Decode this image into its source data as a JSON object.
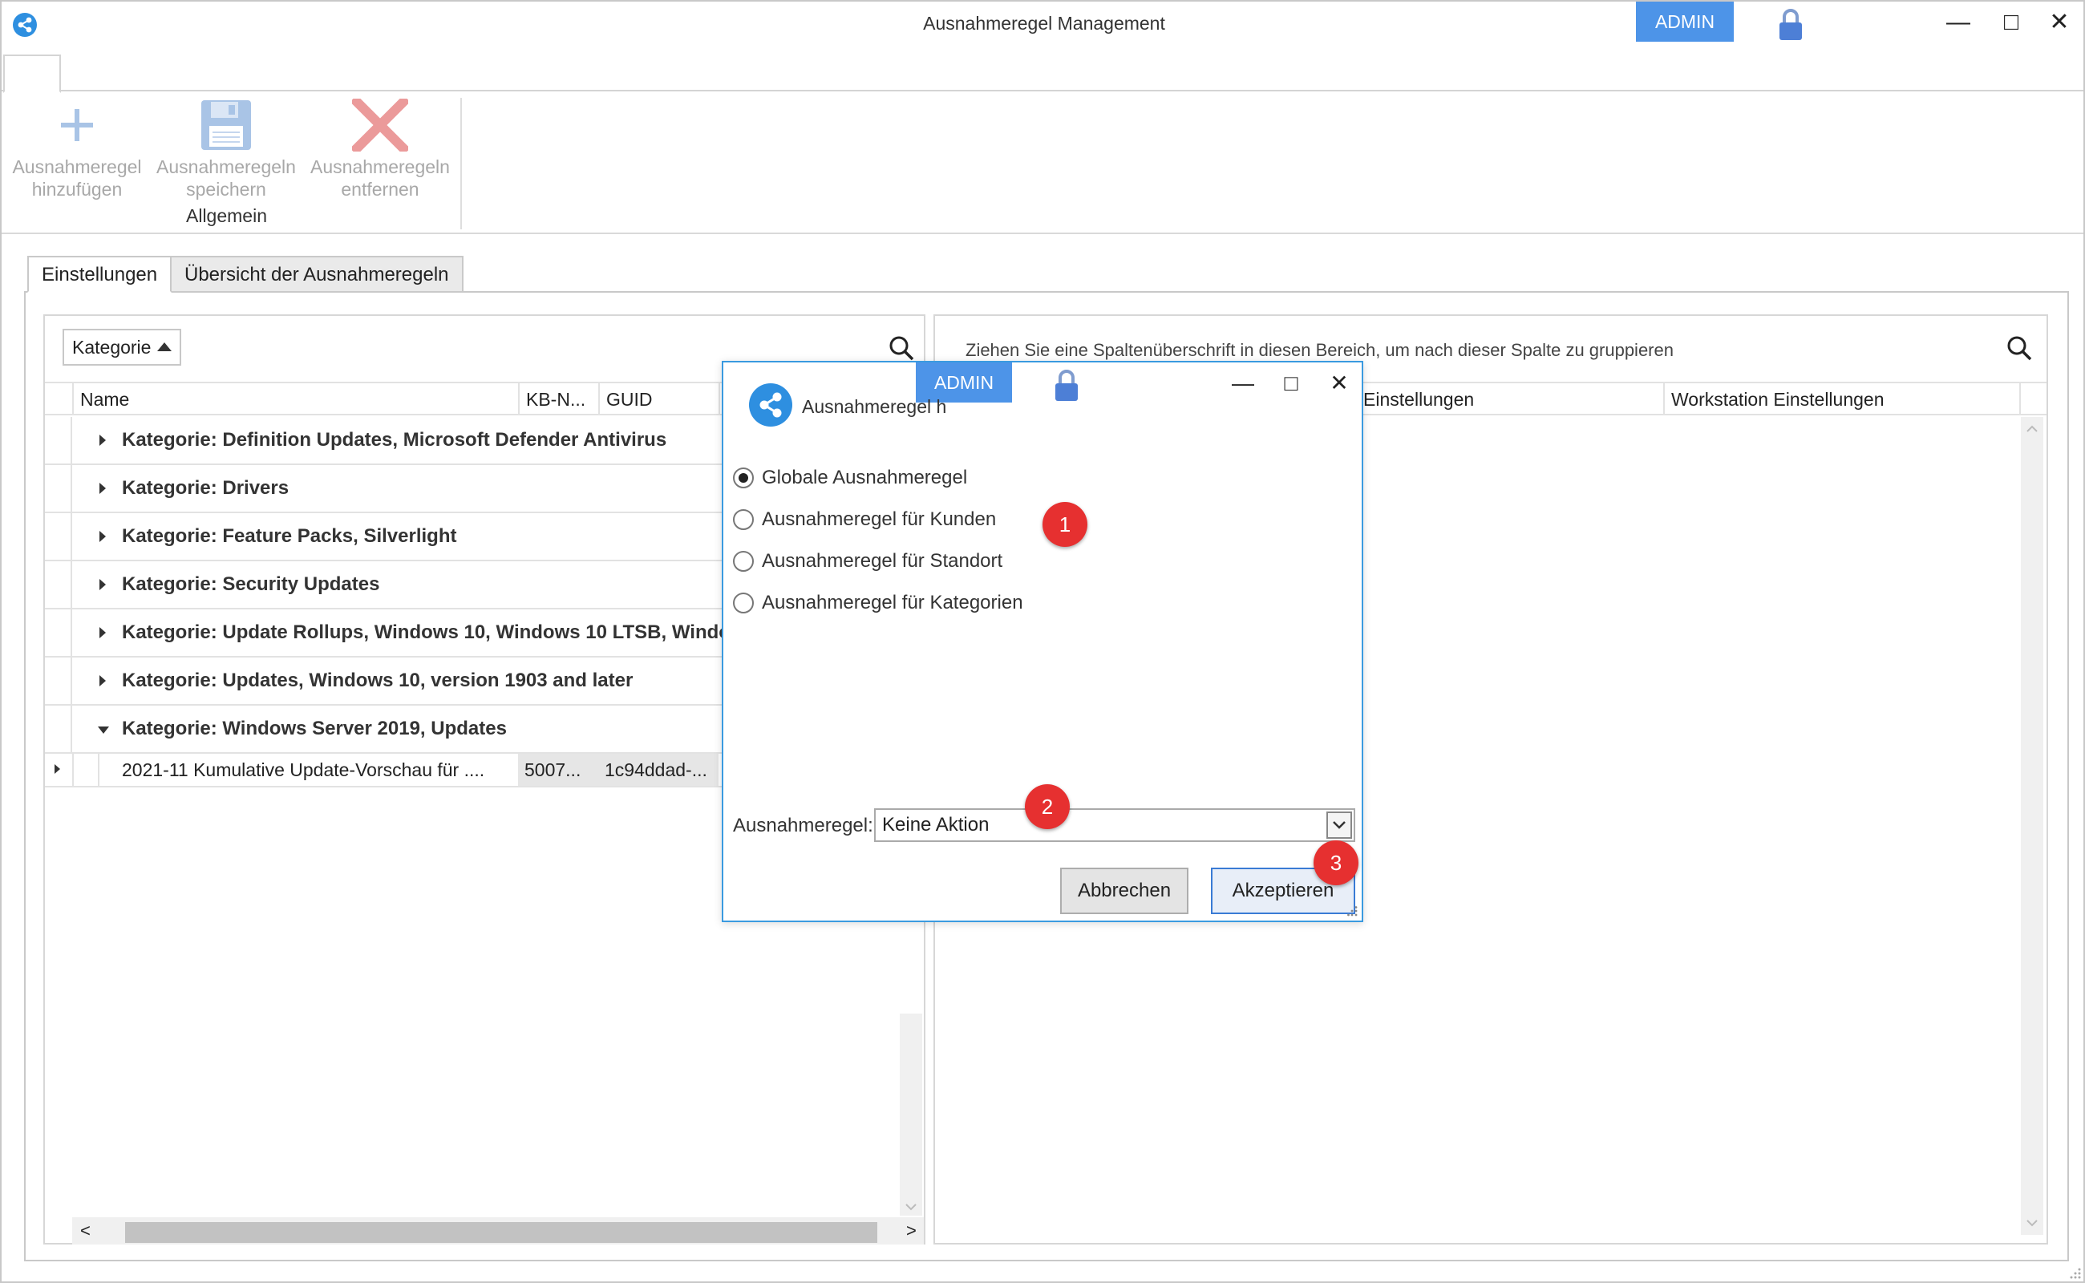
{
  "window": {
    "title": "Ausnahmeregel Management",
    "admin_badge": "ADMIN",
    "controls": {
      "minimize": "—",
      "maximize": "□",
      "close": "✕"
    }
  },
  "ribbon": {
    "buttons": [
      {
        "label_line1": "Ausnahmeregel",
        "label_line2": "hinzufügen",
        "icon": "plus-icon",
        "enabled": false
      },
      {
        "label_line1": "Ausnahmeregeln",
        "label_line2": "speichern",
        "icon": "save-icon",
        "enabled": false
      },
      {
        "label_line1": "Ausnahmeregeln",
        "label_line2": "entfernen",
        "icon": "delete-x-icon",
        "enabled": false
      }
    ],
    "group_label": "Allgemein"
  },
  "tabs": [
    {
      "label": "Einstellungen",
      "active": true
    },
    {
      "label": "Übersicht der Ausnahmeregeln",
      "active": false
    }
  ],
  "left_grid": {
    "group_chip": "Kategorie",
    "columns": [
      "Name",
      "KB-N...",
      "GUID"
    ],
    "groups": [
      {
        "label": "Kategorie: Definition Updates, Microsoft Defender Antivirus",
        "expanded": false
      },
      {
        "label": "Kategorie: Drivers",
        "expanded": false
      },
      {
        "label": "Kategorie: Feature Packs, Silverlight",
        "expanded": false
      },
      {
        "label": "Kategorie: Security Updates",
        "expanded": false
      },
      {
        "label": "Kategorie: Update Rollups, Windows 10, Windows 10 LTSB, Windows",
        "expanded": false
      },
      {
        "label": "Kategorie: Updates, Windows 10, version 1903 and later",
        "expanded": false
      },
      {
        "label": "Kategorie: Windows Server 2019, Updates",
        "expanded": true
      }
    ],
    "rows": [
      {
        "name": "2021-11 Kumulative Update-Vorschau für ....",
        "kb": "5007...",
        "guid": "1c94ddad-..."
      }
    ],
    "scroll": {
      "left": "<",
      "right": ">"
    }
  },
  "right_grid": {
    "drag_hint": "Ziehen Sie eine Spaltenüberschrift in diesen Bereich, um nach dieser Spalte zu gruppieren",
    "columns": [
      "r Einstellungen",
      "Workstation Einstellungen"
    ]
  },
  "dialog": {
    "title": "Ausnahmeregel h",
    "admin_badge": "ADMIN",
    "controls": {
      "minimize": "—",
      "maximize": "□",
      "close": "✕"
    },
    "options": [
      {
        "label": "Globale Ausnahmeregel",
        "checked": true
      },
      {
        "label": "Ausnahmeregel für Kunden",
        "checked": false
      },
      {
        "label": "Ausnahmeregel für Standort",
        "checked": false
      },
      {
        "label": "Ausnahmeregel für Kategorien",
        "checked": false
      }
    ],
    "field_label": "Ausnahmeregel:",
    "select_value": "Keine Aktion",
    "cancel_label": "Abbrechen",
    "accept_label": "Akzeptieren"
  },
  "callouts": [
    "1",
    "2",
    "3"
  ],
  "colors": {
    "accent": "#4d94e8",
    "dialog_border": "#3a9ae0",
    "callout": "#e63030"
  }
}
